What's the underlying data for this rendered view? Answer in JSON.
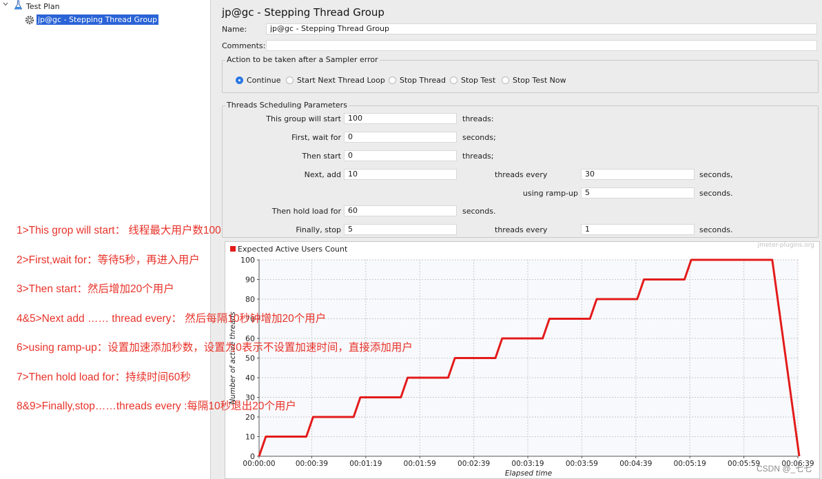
{
  "tree": {
    "root_label": "Test Plan",
    "selected_label": "jp@gc - Stepping Thread Group"
  },
  "panel": {
    "title": "jp@gc - Stepping Thread Group",
    "name_label": "Name:",
    "name_value": "jp@gc - Stepping Thread Group",
    "comments_label": "Comments:",
    "comments_value": ""
  },
  "sampler_error": {
    "group_title": "Action to be taken after a Sampler error",
    "options": [
      {
        "label": "Continue",
        "selected": true
      },
      {
        "label": "Start Next Thread Loop",
        "selected": false
      },
      {
        "label": "Stop Thread",
        "selected": false
      },
      {
        "label": "Stop Test",
        "selected": false
      },
      {
        "label": "Stop Test Now",
        "selected": false
      }
    ]
  },
  "scheduling": {
    "group_title": "Threads Scheduling Parameters",
    "this_group_will_start": {
      "label": "This group will start",
      "value": "100",
      "unit": "threads:"
    },
    "first_wait_for": {
      "label": "First, wait for",
      "value": "0",
      "unit": "seconds;"
    },
    "then_start": {
      "label": "Then start",
      "value": "0",
      "unit": "threads;"
    },
    "next_add": {
      "label": "Next, add",
      "value": "10",
      "mid_label": "threads every",
      "mid_value": "30",
      "unit": "seconds,"
    },
    "ramp_up": {
      "label": "using ramp-up",
      "value": "5",
      "unit": "seconds."
    },
    "hold_load": {
      "label": "Then hold load for",
      "value": "60",
      "unit": "seconds."
    },
    "finally_stop": {
      "label": "Finally, stop",
      "value": "5",
      "mid_label": "threads every",
      "mid_value": "1",
      "unit": "seconds."
    }
  },
  "chart_data": {
    "type": "line",
    "legend": "Expected Active Users Count",
    "legend_placement": "top-left",
    "watermark": "jmeter-plugins.org",
    "xlabel": "Elapsed time",
    "ylabel": "Number of active threads",
    "x_unit": "seconds",
    "xlim": [
      0,
      399
    ],
    "ylim": [
      0,
      100
    ],
    "x_tick_values": [
      0,
      39,
      79,
      119,
      159,
      199,
      239,
      279,
      319,
      359,
      399
    ],
    "x_tick_labels": [
      "00:00:00",
      "00:00:39",
      "00:01:19",
      "00:01:59",
      "00:02:39",
      "00:03:19",
      "00:03:59",
      "00:04:39",
      "00:05:19",
      "00:05:59",
      "00:06:39"
    ],
    "y_ticks": [
      0,
      10,
      20,
      30,
      40,
      50,
      60,
      70,
      80,
      90,
      100
    ],
    "grid": true,
    "color": "#e31b1b",
    "series": [
      {
        "name": "Expected Active Users Count",
        "x": [
          0,
          5,
          35,
          40,
          70,
          75,
          105,
          110,
          140,
          145,
          175,
          180,
          210,
          215,
          245,
          250,
          280,
          285,
          315,
          320,
          380,
          385,
          400
        ],
        "y": [
          0,
          10,
          10,
          20,
          20,
          30,
          30,
          40,
          40,
          50,
          50,
          60,
          60,
          70,
          70,
          80,
          80,
          90,
          90,
          100,
          100,
          75,
          0
        ]
      }
    ]
  },
  "annotations": [
    "1>This grop will start： 线程最大用户数100",
    "2>First,wait for：等待5秒，再进入用户",
    "3>Then start：然后增加20个用户",
    "4&5>Next add …… thread every：  然后每隔10秒钟增加20个用户",
    "6>using ramp-up：设置加速添加秒数，设置为0表示不设置加速时间，直接添加用户",
    "7>Then hold load for：持续时间60秒",
    "8&9>Finally,stop……threads every :每隔10秒退出20个用户"
  ],
  "csdn_watermark": "CSDN @_七七"
}
